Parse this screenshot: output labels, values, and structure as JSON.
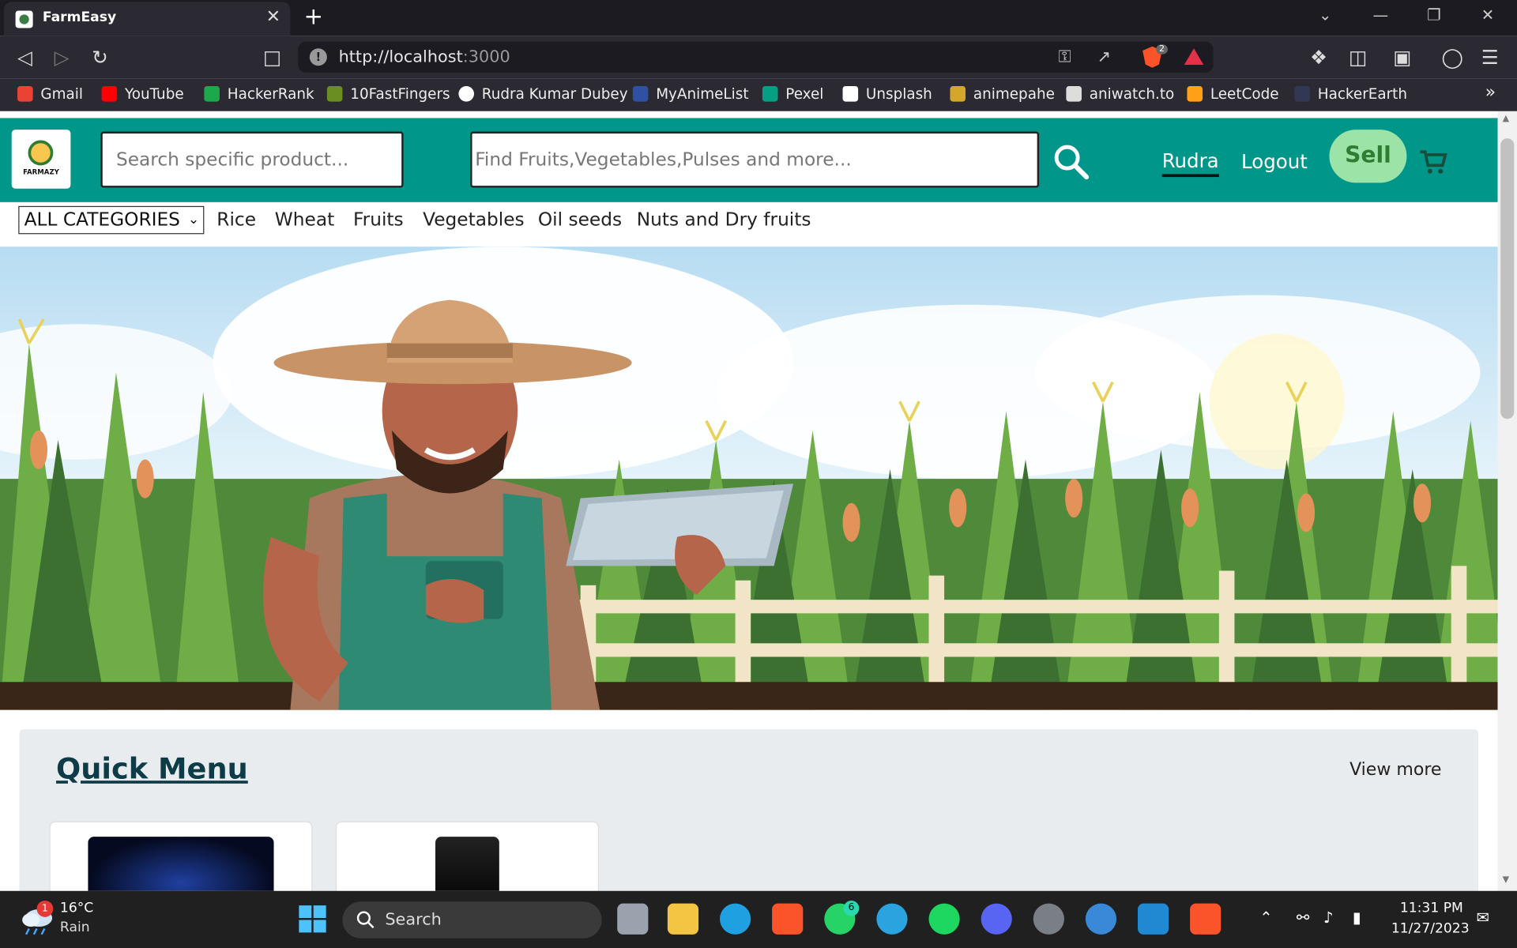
{
  "browser": {
    "tab_title": "FarmEasy",
    "tab_close": "✕",
    "new_tab": "+",
    "url_host": "http://localhost",
    "url_port": ":3000",
    "brave_badge": "2",
    "bookmarks": [
      {
        "label": "Gmail",
        "color": "#ea4335"
      },
      {
        "label": "YouTube",
        "color": "#ff0000"
      },
      {
        "label": "HackerRank",
        "color": "#1ba94c"
      },
      {
        "label": "10FastFingers",
        "color": "#6b8e23"
      },
      {
        "label": "Rudra Kumar Dubey",
        "color": "#ffffff"
      },
      {
        "label": "MyAnimeList",
        "color": "#2e51a2"
      },
      {
        "label": "Pexel",
        "color": "#05a081"
      },
      {
        "label": "Unsplash",
        "color": "#ffffff"
      },
      {
        "label": "animepahe",
        "color": "#d4a72c"
      },
      {
        "label": "aniwatch.to",
        "color": "#dddddd"
      },
      {
        "label": "LeetCode",
        "color": "#ffa116"
      },
      {
        "label": "HackerEarth",
        "color": "#323754"
      }
    ],
    "bookmarks_more": "»"
  },
  "header": {
    "logo_text": "FARMAZY",
    "search_product_placeholder": "Search specific product...",
    "search_main_placeholder": "Find Fruits,Vegetables,Pulses and more...",
    "user_name": "Rudra",
    "logout_label": "Logout",
    "sell_label": "Sell",
    "accent_color": "#00978a"
  },
  "categories": {
    "selected": "ALL CATEGORIES",
    "links": [
      "Rice",
      "Wheat",
      "Fruits",
      "Vegetables",
      "Oil seeds",
      "Nuts and Dry fruits"
    ]
  },
  "quick_menu": {
    "title": "Quick Menu",
    "view_more": "View more"
  },
  "taskbar": {
    "weather_temp": "16°C",
    "weather_desc": "Rain",
    "weather_badge": "1",
    "search_label": "Search",
    "whatsapp_badge": "6",
    "time": "11:31 PM",
    "date": "11/27/2023"
  }
}
